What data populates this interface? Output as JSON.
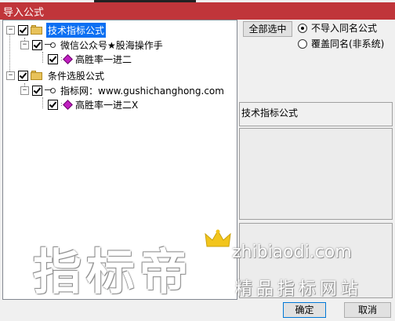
{
  "window": {
    "title": "导入公式"
  },
  "tree": {
    "groups": [
      {
        "label": "技术指标公式",
        "selected": true,
        "child": {
          "label": "微信公众号★股海操作手",
          "leaf": "高胜率一进二"
        }
      },
      {
        "label": "条件选股公式",
        "selected": false,
        "child": {
          "label": "指标网：www.gushichanghong.com",
          "leaf": "高胜率一进二X"
        }
      }
    ]
  },
  "options": {
    "select_all_label": "全部选中",
    "radio_no_import": "不导入同名公式",
    "radio_overwrite": "覆盖同名(非系统)",
    "selected_radio": "no_import"
  },
  "info_panel": {
    "title": "技术指标公式"
  },
  "buttons": {
    "ok": "确定",
    "cancel": "取消"
  },
  "watermark": {
    "main": "指标帝",
    "url": "zhibiaodi.com",
    "sub": "精品指标网站"
  },
  "colors": {
    "titlebar": "#c0353a",
    "selection": "#0b6ff2",
    "gem": "#c01fc0",
    "folder": "#e8c25a"
  }
}
